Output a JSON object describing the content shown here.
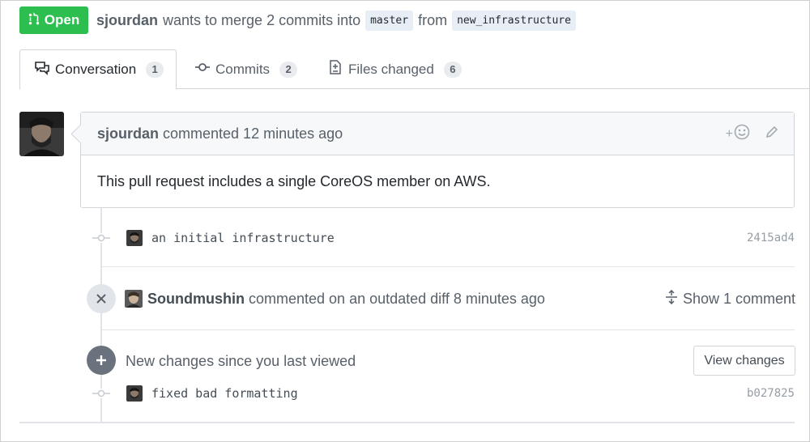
{
  "pr": {
    "state": "Open",
    "author": "sjourdan",
    "merge_text": "wants to merge 2 commits into",
    "base_branch": "master",
    "from_text": "from",
    "head_branch": "new_infrastructure"
  },
  "tabs": [
    {
      "label": "Conversation",
      "count": "1",
      "icon": "comment-discussion-icon"
    },
    {
      "label": "Commits",
      "count": "2",
      "icon": "git-commit-icon"
    },
    {
      "label": "Files changed",
      "count": "6",
      "icon": "file-diff-icon"
    }
  ],
  "comment": {
    "author": "sjourdan",
    "meta": "commented 12 minutes ago",
    "body": "This pull request includes a single CoreOS member on AWS.",
    "actions": {
      "reaction": "+",
      "reaction_icon": "smiley-icon",
      "edit_icon": "pencil-icon"
    }
  },
  "timeline": {
    "commit1": {
      "message": "an initial infrastructure",
      "sha": "2415ad4"
    },
    "outdated": {
      "author": "Soundmushin",
      "text": "commented on an outdated diff 8 minutes ago",
      "show_label": "Show 1 comment",
      "show_icon": "unfold-icon"
    },
    "new_changes": {
      "text": "New changes since you last viewed",
      "button": "View changes"
    },
    "commit2": {
      "message": "fixed bad formatting",
      "sha": "b027825"
    }
  },
  "colors": {
    "open_green": "#2cbe4e",
    "badge_dark": "#6a737d",
    "badge_grey": "#e1e4e8"
  }
}
